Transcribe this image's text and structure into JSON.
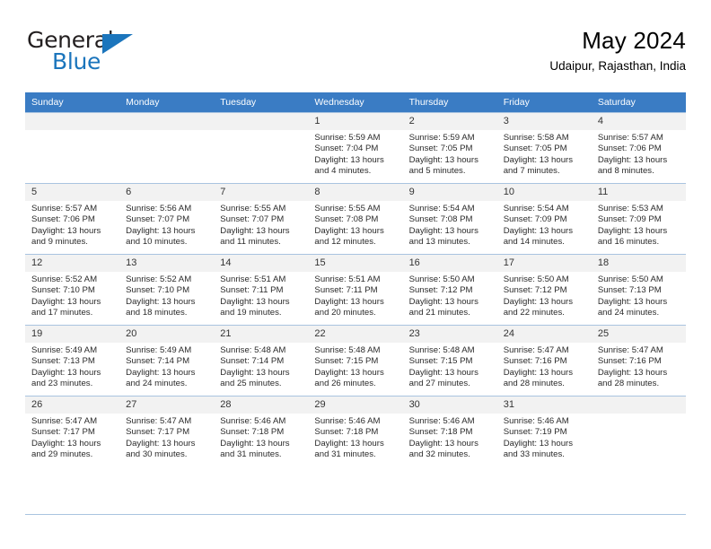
{
  "brand": {
    "name_top": "General",
    "name_bottom": "Blue"
  },
  "header": {
    "title": "May 2024",
    "subtitle": "Udaipur, Rajasthan, India"
  },
  "weekdays": [
    "Sunday",
    "Monday",
    "Tuesday",
    "Wednesday",
    "Thursday",
    "Friday",
    "Saturday"
  ],
  "colors": {
    "header_bar": "#3a7cc4",
    "brand_blue": "#1b75bc",
    "daynum_bg": "#f2f2f2",
    "grid_line": "#a9c4e0"
  },
  "labels": {
    "sunrise": "Sunrise:",
    "sunset": "Sunset:",
    "daylight": "Daylight:"
  },
  "weeks": [
    [
      {
        "day": "",
        "empty": true
      },
      {
        "day": "",
        "empty": true
      },
      {
        "day": "",
        "empty": true
      },
      {
        "day": "1",
        "sunrise": "Sunrise: 5:59 AM",
        "sunset": "Sunset: 7:04 PM",
        "daylight": "Daylight: 13 hours and 4 minutes."
      },
      {
        "day": "2",
        "sunrise": "Sunrise: 5:59 AM",
        "sunset": "Sunset: 7:05 PM",
        "daylight": "Daylight: 13 hours and 5 minutes."
      },
      {
        "day": "3",
        "sunrise": "Sunrise: 5:58 AM",
        "sunset": "Sunset: 7:05 PM",
        "daylight": "Daylight: 13 hours and 7 minutes."
      },
      {
        "day": "4",
        "sunrise": "Sunrise: 5:57 AM",
        "sunset": "Sunset: 7:06 PM",
        "daylight": "Daylight: 13 hours and 8 minutes."
      }
    ],
    [
      {
        "day": "5",
        "sunrise": "Sunrise: 5:57 AM",
        "sunset": "Sunset: 7:06 PM",
        "daylight": "Daylight: 13 hours and 9 minutes."
      },
      {
        "day": "6",
        "sunrise": "Sunrise: 5:56 AM",
        "sunset": "Sunset: 7:07 PM",
        "daylight": "Daylight: 13 hours and 10 minutes."
      },
      {
        "day": "7",
        "sunrise": "Sunrise: 5:55 AM",
        "sunset": "Sunset: 7:07 PM",
        "daylight": "Daylight: 13 hours and 11 minutes."
      },
      {
        "day": "8",
        "sunrise": "Sunrise: 5:55 AM",
        "sunset": "Sunset: 7:08 PM",
        "daylight": "Daylight: 13 hours and 12 minutes."
      },
      {
        "day": "9",
        "sunrise": "Sunrise: 5:54 AM",
        "sunset": "Sunset: 7:08 PM",
        "daylight": "Daylight: 13 hours and 13 minutes."
      },
      {
        "day": "10",
        "sunrise": "Sunrise: 5:54 AM",
        "sunset": "Sunset: 7:09 PM",
        "daylight": "Daylight: 13 hours and 14 minutes."
      },
      {
        "day": "11",
        "sunrise": "Sunrise: 5:53 AM",
        "sunset": "Sunset: 7:09 PM",
        "daylight": "Daylight: 13 hours and 16 minutes."
      }
    ],
    [
      {
        "day": "12",
        "sunrise": "Sunrise: 5:52 AM",
        "sunset": "Sunset: 7:10 PM",
        "daylight": "Daylight: 13 hours and 17 minutes."
      },
      {
        "day": "13",
        "sunrise": "Sunrise: 5:52 AM",
        "sunset": "Sunset: 7:10 PM",
        "daylight": "Daylight: 13 hours and 18 minutes."
      },
      {
        "day": "14",
        "sunrise": "Sunrise: 5:51 AM",
        "sunset": "Sunset: 7:11 PM",
        "daylight": "Daylight: 13 hours and 19 minutes."
      },
      {
        "day": "15",
        "sunrise": "Sunrise: 5:51 AM",
        "sunset": "Sunset: 7:11 PM",
        "daylight": "Daylight: 13 hours and 20 minutes."
      },
      {
        "day": "16",
        "sunrise": "Sunrise: 5:50 AM",
        "sunset": "Sunset: 7:12 PM",
        "daylight": "Daylight: 13 hours and 21 minutes."
      },
      {
        "day": "17",
        "sunrise": "Sunrise: 5:50 AM",
        "sunset": "Sunset: 7:12 PM",
        "daylight": "Daylight: 13 hours and 22 minutes."
      },
      {
        "day": "18",
        "sunrise": "Sunrise: 5:50 AM",
        "sunset": "Sunset: 7:13 PM",
        "daylight": "Daylight: 13 hours and 24 minutes."
      }
    ],
    [
      {
        "day": "19",
        "sunrise": "Sunrise: 5:49 AM",
        "sunset": "Sunset: 7:13 PM",
        "daylight": "Daylight: 13 hours and 23 minutes."
      },
      {
        "day": "20",
        "sunrise": "Sunrise: 5:49 AM",
        "sunset": "Sunset: 7:14 PM",
        "daylight": "Daylight: 13 hours and 24 minutes."
      },
      {
        "day": "21",
        "sunrise": "Sunrise: 5:48 AM",
        "sunset": "Sunset: 7:14 PM",
        "daylight": "Daylight: 13 hours and 25 minutes."
      },
      {
        "day": "22",
        "sunrise": "Sunrise: 5:48 AM",
        "sunset": "Sunset: 7:15 PM",
        "daylight": "Daylight: 13 hours and 26 minutes."
      },
      {
        "day": "23",
        "sunrise": "Sunrise: 5:48 AM",
        "sunset": "Sunset: 7:15 PM",
        "daylight": "Daylight: 13 hours and 27 minutes."
      },
      {
        "day": "24",
        "sunrise": "Sunrise: 5:47 AM",
        "sunset": "Sunset: 7:16 PM",
        "daylight": "Daylight: 13 hours and 28 minutes."
      },
      {
        "day": "25",
        "sunrise": "Sunrise: 5:47 AM",
        "sunset": "Sunset: 7:16 PM",
        "daylight": "Daylight: 13 hours and 28 minutes."
      }
    ],
    [
      {
        "day": "26",
        "sunrise": "Sunrise: 5:47 AM",
        "sunset": "Sunset: 7:17 PM",
        "daylight": "Daylight: 13 hours and 29 minutes."
      },
      {
        "day": "27",
        "sunrise": "Sunrise: 5:47 AM",
        "sunset": "Sunset: 7:17 PM",
        "daylight": "Daylight: 13 hours and 30 minutes."
      },
      {
        "day": "28",
        "sunrise": "Sunrise: 5:46 AM",
        "sunset": "Sunset: 7:18 PM",
        "daylight": "Daylight: 13 hours and 31 minutes."
      },
      {
        "day": "29",
        "sunrise": "Sunrise: 5:46 AM",
        "sunset": "Sunset: 7:18 PM",
        "daylight": "Daylight: 13 hours and 31 minutes."
      },
      {
        "day": "30",
        "sunrise": "Sunrise: 5:46 AM",
        "sunset": "Sunset: 7:18 PM",
        "daylight": "Daylight: 13 hours and 32 minutes."
      },
      {
        "day": "31",
        "sunrise": "Sunrise: 5:46 AM",
        "sunset": "Sunset: 7:19 PM",
        "daylight": "Daylight: 13 hours and 33 minutes."
      },
      {
        "day": "",
        "empty": true
      }
    ]
  ]
}
